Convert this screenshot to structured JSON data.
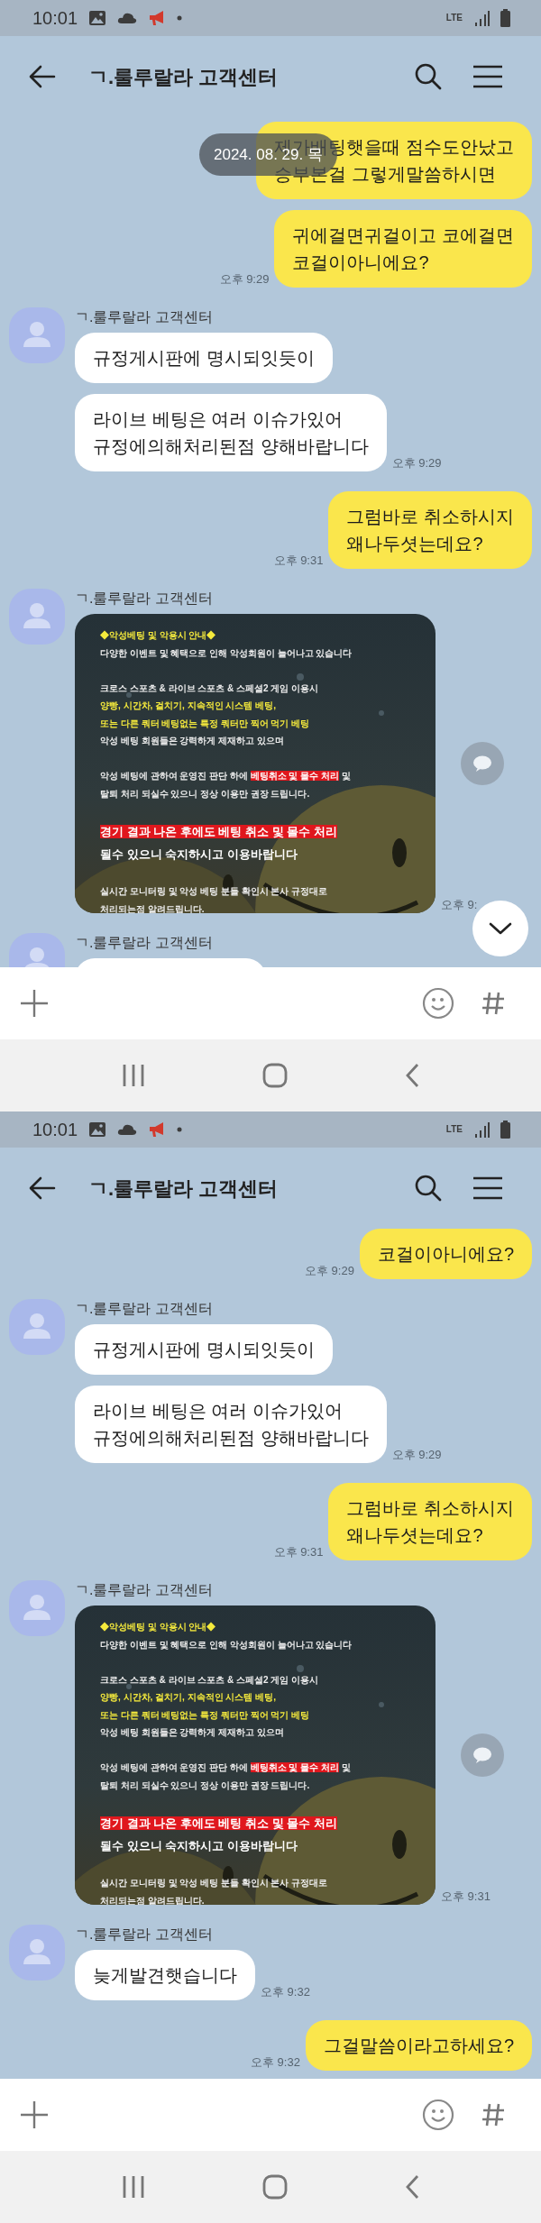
{
  "screens": [
    {
      "status_bar": {
        "time": "10:01",
        "network": "LTE"
      },
      "header": {
        "title": "ㄱ.룰루랄라 고객센터"
      },
      "date_overlay": "2024. 08. 29. 목",
      "scroll_to_bottom_button": true,
      "messages": [
        {
          "kind": "sent",
          "text": "제가배팅햇을때 점수도안났고\n승부본걸 그렇게말씀하시면"
        },
        {
          "kind": "sent",
          "text": "귀에걸면귀걸이고 코에걸면\n코걸이아니에요?",
          "time": "오후 9:29"
        },
        {
          "kind": "received",
          "sender": "ㄱ.룰루랄라 고객센터",
          "bubbles": [
            {
              "kind": "text",
              "text": "규정게시판에 명시되잇듯이"
            },
            {
              "kind": "text",
              "text": "라이브 베팅은 여러 이슈가있어\n규정에의해처리된점 양해바랍니다",
              "time": "오후 9:29"
            }
          ]
        },
        {
          "kind": "sent",
          "text": "그럼바로 취소하시지\n왜나두셧는데요?",
          "time": "오후 9:31"
        },
        {
          "kind": "received",
          "sender": "ㄱ.룰루랄라 고객센터",
          "bubbles": [
            {
              "kind": "notice_image",
              "time": "오후 9:",
              "lines": [
                {
                  "kind": "accent",
                  "segments": [
                    {
                      "text": "◆악성베팅 및 악용시 안내◆"
                    }
                  ]
                },
                {
                  "kind": "normal",
                  "segments": [
                    {
                      "text": "다양한 이벤트 및 혜택으로 인해 악성회원이 늘어나고 있습니다"
                    }
                  ]
                },
                {
                  "kind": "gap"
                },
                {
                  "kind": "normal",
                  "segments": [
                    {
                      "text": "크로스 스포츠 & 라이브 스포츠 & 스페셜2 게임 이용시"
                    }
                  ]
                },
                {
                  "kind": "accent",
                  "segments": [
                    {
                      "text": "양빵, 시간차, 걸치기, 지속적인 시스템 베팅,"
                    }
                  ]
                },
                {
                  "kind": "accent",
                  "segments": [
                    {
                      "text": "또는 다른 쿼터 베팅없는 특정 쿼터만 찍어 먹기 베팅"
                    }
                  ]
                },
                {
                  "kind": "normal",
                  "segments": [
                    {
                      "text": "악성 베팅 회원들은 강력하게 제재하고 있으며"
                    }
                  ]
                },
                {
                  "kind": "gap"
                },
                {
                  "kind": "normal",
                  "segments": [
                    {
                      "text": "악성 베팅에 관하여 운영진 판단 하에 "
                    },
                    {
                      "text": "베팅취소 및 몰수 처리",
                      "highlighted": true
                    },
                    {
                      "text": " 및"
                    }
                  ]
                },
                {
                  "kind": "normal",
                  "segments": [
                    {
                      "text": "탈퇴 처리 되실수 있으니 정상 이용만 권장 드립니다."
                    }
                  ]
                },
                {
                  "kind": "gap"
                },
                {
                  "kind": "large",
                  "segments": [
                    {
                      "text": "경기 결과 나온 후에도 베팅 취소 및 몰수 처리",
                      "highlighted": true
                    }
                  ]
                },
                {
                  "kind": "large",
                  "segments": [
                    {
                      "text": "될수 있으니 숙지하시고 이용바랍니다"
                    }
                  ]
                },
                {
                  "kind": "gap"
                },
                {
                  "kind": "normal",
                  "segments": [
                    {
                      "text": "실시간 모니터링 및 악성 베팅 분들 확인시 본사 규정대로"
                    }
                  ]
                },
                {
                  "kind": "normal",
                  "segments": [
                    {
                      "text": "처리되는점 알려드립니다."
                    }
                  ]
                }
              ]
            }
          ]
        },
        {
          "kind": "received",
          "sender": "ㄱ.룰루랄라 고객센터",
          "bubbles": [
            {
              "kind": "cut_off"
            }
          ]
        }
      ]
    },
    {
      "status_bar": {
        "time": "10:01",
        "network": "LTE"
      },
      "header": {
        "title": "ㄱ.룰루랄라 고객센터"
      },
      "messages": [
        {
          "kind": "sent",
          "text": "코걸이아니에요?",
          "time": "오후 9:29"
        },
        {
          "kind": "received",
          "sender": "ㄱ.룰루랄라 고객센터",
          "bubbles": [
            {
              "kind": "text",
              "text": "규정게시판에 명시되잇듯이"
            },
            {
              "kind": "text",
              "text": "라이브 베팅은 여러 이슈가있어\n규정에의해처리된점 양해바랍니다",
              "time": "오후 9:29"
            }
          ]
        },
        {
          "kind": "sent",
          "text": "그럼바로 취소하시지\n왜나두셧는데요?",
          "time": "오후 9:31"
        },
        {
          "kind": "received",
          "sender": "ㄱ.룰루랄라 고객센터",
          "bubbles": [
            {
              "kind": "notice_image",
              "time": "오후 9:31",
              "lines": [
                {
                  "kind": "accent",
                  "segments": [
                    {
                      "text": "◆악성베팅 및 악용시 안내◆"
                    }
                  ]
                },
                {
                  "kind": "normal",
                  "segments": [
                    {
                      "text": "다양한 이벤트 및 혜택으로 인해 악성회원이 늘어나고 있습니다"
                    }
                  ]
                },
                {
                  "kind": "gap"
                },
                {
                  "kind": "normal",
                  "segments": [
                    {
                      "text": "크로스 스포츠 & 라이브 스포츠 & 스페셜2 게임 이용시"
                    }
                  ]
                },
                {
                  "kind": "accent",
                  "segments": [
                    {
                      "text": "양빵, 시간차, 걸치기, 지속적인 시스템 베팅,"
                    }
                  ]
                },
                {
                  "kind": "accent",
                  "segments": [
                    {
                      "text": "또는 다른 쿼터 베팅없는 특정 쿼터만 찍어 먹기 베팅"
                    }
                  ]
                },
                {
                  "kind": "normal",
                  "segments": [
                    {
                      "text": "악성 베팅 회원들은 강력하게 제재하고 있으며"
                    }
                  ]
                },
                {
                  "kind": "gap"
                },
                {
                  "kind": "normal",
                  "segments": [
                    {
                      "text": "악성 베팅에 관하여 운영진 판단 하에 "
                    },
                    {
                      "text": "베팅취소 및 몰수 처리",
                      "highlighted": true
                    },
                    {
                      "text": " 및"
                    }
                  ]
                },
                {
                  "kind": "normal",
                  "segments": [
                    {
                      "text": "탈퇴 처리 되실수 있으니 정상 이용만 권장 드립니다."
                    }
                  ]
                },
                {
                  "kind": "gap"
                },
                {
                  "kind": "large",
                  "segments": [
                    {
                      "text": "경기 결과 나온 후에도 베팅 취소 및 몰수 처리",
                      "highlighted": true
                    }
                  ]
                },
                {
                  "kind": "large",
                  "segments": [
                    {
                      "text": "될수 있으니 숙지하시고 이용바랍니다"
                    }
                  ]
                },
                {
                  "kind": "gap"
                },
                {
                  "kind": "normal",
                  "segments": [
                    {
                      "text": "실시간 모니터링 및 악성 베팅 분들 확인시 본사 규정대로"
                    }
                  ]
                },
                {
                  "kind": "normal",
                  "segments": [
                    {
                      "text": "처리되는점 알려드립니다."
                    }
                  ]
                }
              ]
            }
          ]
        },
        {
          "kind": "received",
          "sender": "ㄱ.룰루랄라 고객센터",
          "bubbles": [
            {
              "kind": "text",
              "text": "늦게발견햇습니다",
              "time": "오후 9:32"
            }
          ]
        },
        {
          "kind": "sent",
          "text": "그걸말씀이라고하세요?",
          "time": "오후 9:32"
        }
      ]
    }
  ]
}
